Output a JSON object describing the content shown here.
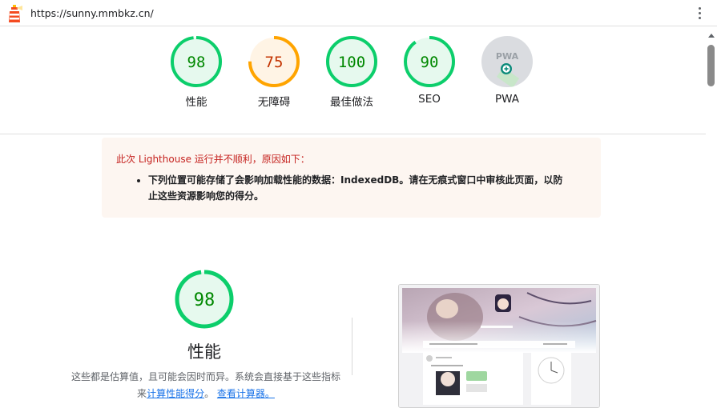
{
  "browser": {
    "url": "https://sunny.mmbkz.cn/",
    "logo_icon": "lighthouse-icon",
    "menu_icon": "kebab-menu-icon"
  },
  "colors": {
    "pass": "#0cce6b",
    "pass_text": "#008800",
    "pass_bg": "#e6f9ee",
    "average": "#ffa400",
    "average_text": "#c33300",
    "average_bg": "#fff4e5",
    "warning_text": "#c5221f",
    "link": "#1a73e8"
  },
  "gauges": [
    {
      "label": "性能",
      "score": "98",
      "value": 98,
      "status": "pass"
    },
    {
      "label": "无障碍",
      "score": "75",
      "value": 75,
      "status": "average"
    },
    {
      "label": "最佳做法",
      "score": "100",
      "value": 100,
      "status": "pass"
    },
    {
      "label": "SEO",
      "score": "90",
      "value": 90,
      "status": "pass"
    },
    {
      "label": "PWA",
      "badge": "PWA",
      "status": "pwa",
      "icon": "pwa-badge-icon"
    }
  ],
  "warning": {
    "title": "此次 Lighthouse 运行并不顺利，原因如下：",
    "items": [
      "下列位置可能存储了会影响加载性能的数据：IndexedDB。请在无痕式窗口中审核此页面，以防止这些资源影响您的得分。"
    ]
  },
  "performance": {
    "score": "98",
    "value": 98,
    "title": "性能",
    "desc_prefix": "这些都是估算值，且可能会因时而异。系统会直接基于这些指标来",
    "desc_link1": "计算性能得分",
    "desc_mid": "。",
    "desc_link2": "查看计算器。"
  }
}
